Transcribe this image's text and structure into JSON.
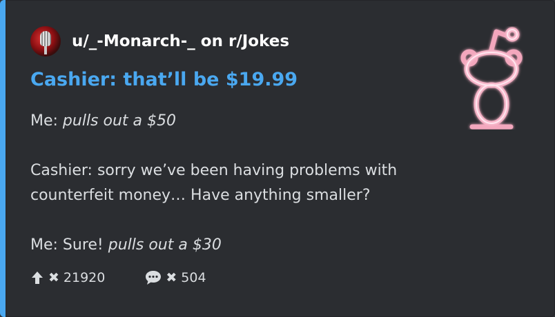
{
  "author": {
    "name": "u/_-Monarch-_ on r/Jokes"
  },
  "post": {
    "title": "Cashier: that’ll be $19.99",
    "lines": [
      {
        "plain": "Me: ",
        "italic": "pulls out a $50"
      },
      {
        "plain": "Cashier: sorry we’ve been having problems with counterfeit money… Have anything smaller?",
        "italic": ""
      },
      {
        "plain": "Me: Sure! ",
        "italic": "pulls out a $30"
      }
    ]
  },
  "stats": {
    "upvotes": "21920",
    "comments": "504",
    "multiplier": "✖"
  },
  "colors": {
    "accent": "#4aa8f0",
    "background": "#2b2d31",
    "text": "#dbdee1",
    "thumbnail": "#f0a8bc"
  },
  "icons": {
    "avatar": "microphone-avatar",
    "thumbnail": "reddit-snoo-icon",
    "upvote": "up-arrow-icon",
    "comments": "speech-bubble-icon"
  }
}
